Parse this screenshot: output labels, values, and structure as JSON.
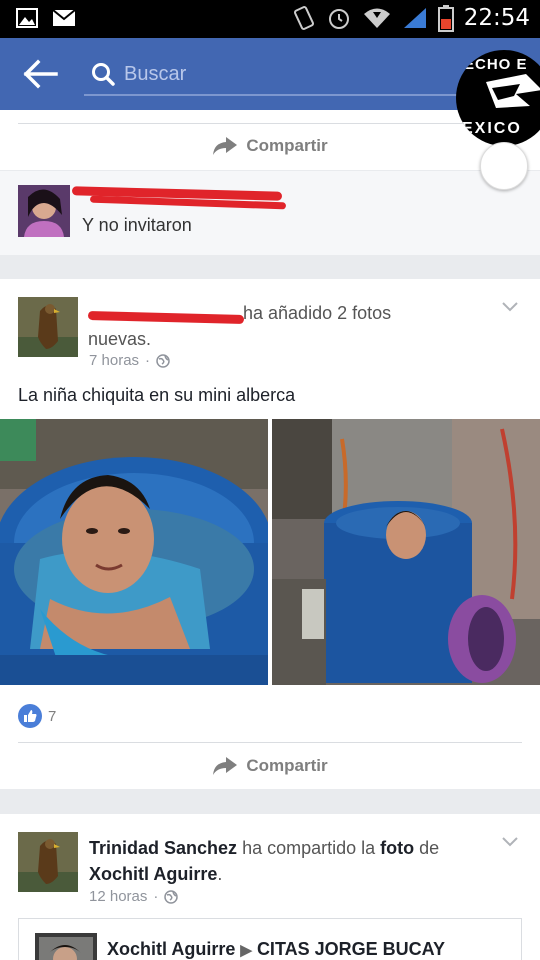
{
  "statusbar": {
    "time": "22:54"
  },
  "appbar": {
    "search_placeholder": "Buscar"
  },
  "overlay": {
    "text_top": "ECHO E",
    "text_bottom": "EXICO"
  },
  "share_label": "Compartir",
  "comment": {
    "text": "Y no invitaron"
  },
  "post1": {
    "action": "ha añadido 2 fotos nuevas.",
    "time": "7 horas",
    "caption": "La niña chiquita en su mini alberca",
    "likes": "7"
  },
  "post2": {
    "author": "Trinidad Sanchez",
    "action": "ha compartido la",
    "object": "foto",
    "preposition": "de",
    "target": "Xochitl Aguirre",
    "time": "12 horas",
    "shared_author": "Xochitl Aguirre",
    "shared_group": "CITAS JORGE BUCAY"
  },
  "colors": {
    "brand": "#4267b2",
    "redaction": "#e0242a",
    "like": "#4a7ed8"
  }
}
